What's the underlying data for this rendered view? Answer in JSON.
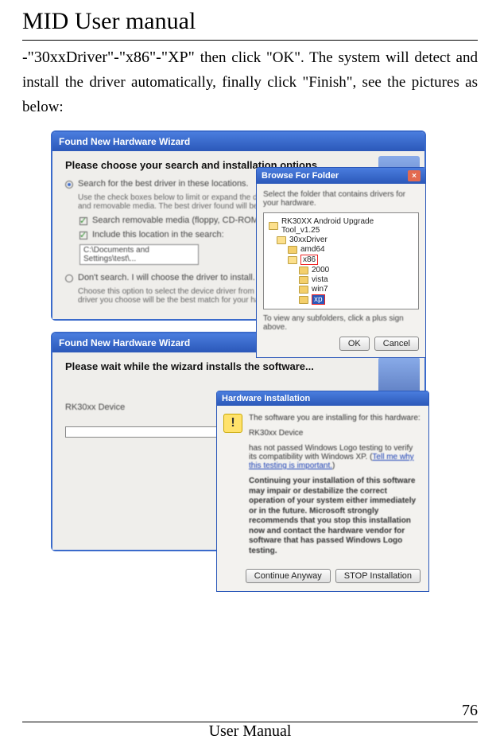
{
  "header": {
    "title": "MID User manual"
  },
  "body": {
    "line1_prefix": "-\"30xxDriver\"-\"x86\"-\"XP\"",
    "line1_rest": "then click \"OK\". The system will detect and install the driver automatically, finally click \"Finish\", see the pictures as below:"
  },
  "fig1": {
    "wizard_title": "Found New Hardware Wizard",
    "heading": "Please choose your search and installation options.",
    "opt1_label": "Search for the best driver in these locations.",
    "opt1_desc": "Use the check boxes below to limit or expand the default search, which includes local paths and removable media. The best driver found will be installed.",
    "chk1_label": "Search removable media (floppy, CD-ROM...)",
    "chk2_label": "Include this location in the search:",
    "path_value": "C:\\Documents and Settings\\test\\...",
    "opt2_label": "Don't search. I will choose the driver to install.",
    "opt2_desc": "Choose this option to select the device driver from a list. Windows does not guarantee that the driver you choose will be the best match for your hardware.",
    "browse": {
      "title": "Browse For Folder",
      "message": "Select the folder that contains drivers for your hardware.",
      "root": "RK30XX Android Upgrade Tool_v1.25",
      "item_driver": "30xxDriver",
      "items": [
        "amd64",
        "x86",
        "2000",
        "vista",
        "win7",
        "xp"
      ],
      "note": "To view any subfolders, click a plus sign above.",
      "ok": "OK",
      "cancel": "Cancel"
    }
  },
  "fig2": {
    "wizard_title": "Found New Hardware Wizard",
    "heading": "Please wait while the wizard installs the software...",
    "device": "RK30xx Device",
    "warn": {
      "title": "Hardware Installation",
      "p1": "The software you are installing for this hardware:",
      "dev": "RK30xx Device",
      "p2a": "has not passed Windows Logo testing to verify its compatibility with Windows XP. (",
      "p2_link": "Tell me why this testing is important.",
      "p2b": ")",
      "p3": "Continuing your installation of this software may impair or destabilize the correct operation of your system either immediately or in the future. Microsoft strongly recommends that you stop this installation now and contact the hardware vendor for software that has passed Windows Logo testing.",
      "btn_continue": "Continue Anyway",
      "btn_stop": "STOP Installation"
    }
  },
  "footer": {
    "page_number": "76",
    "label": "User Manual"
  }
}
